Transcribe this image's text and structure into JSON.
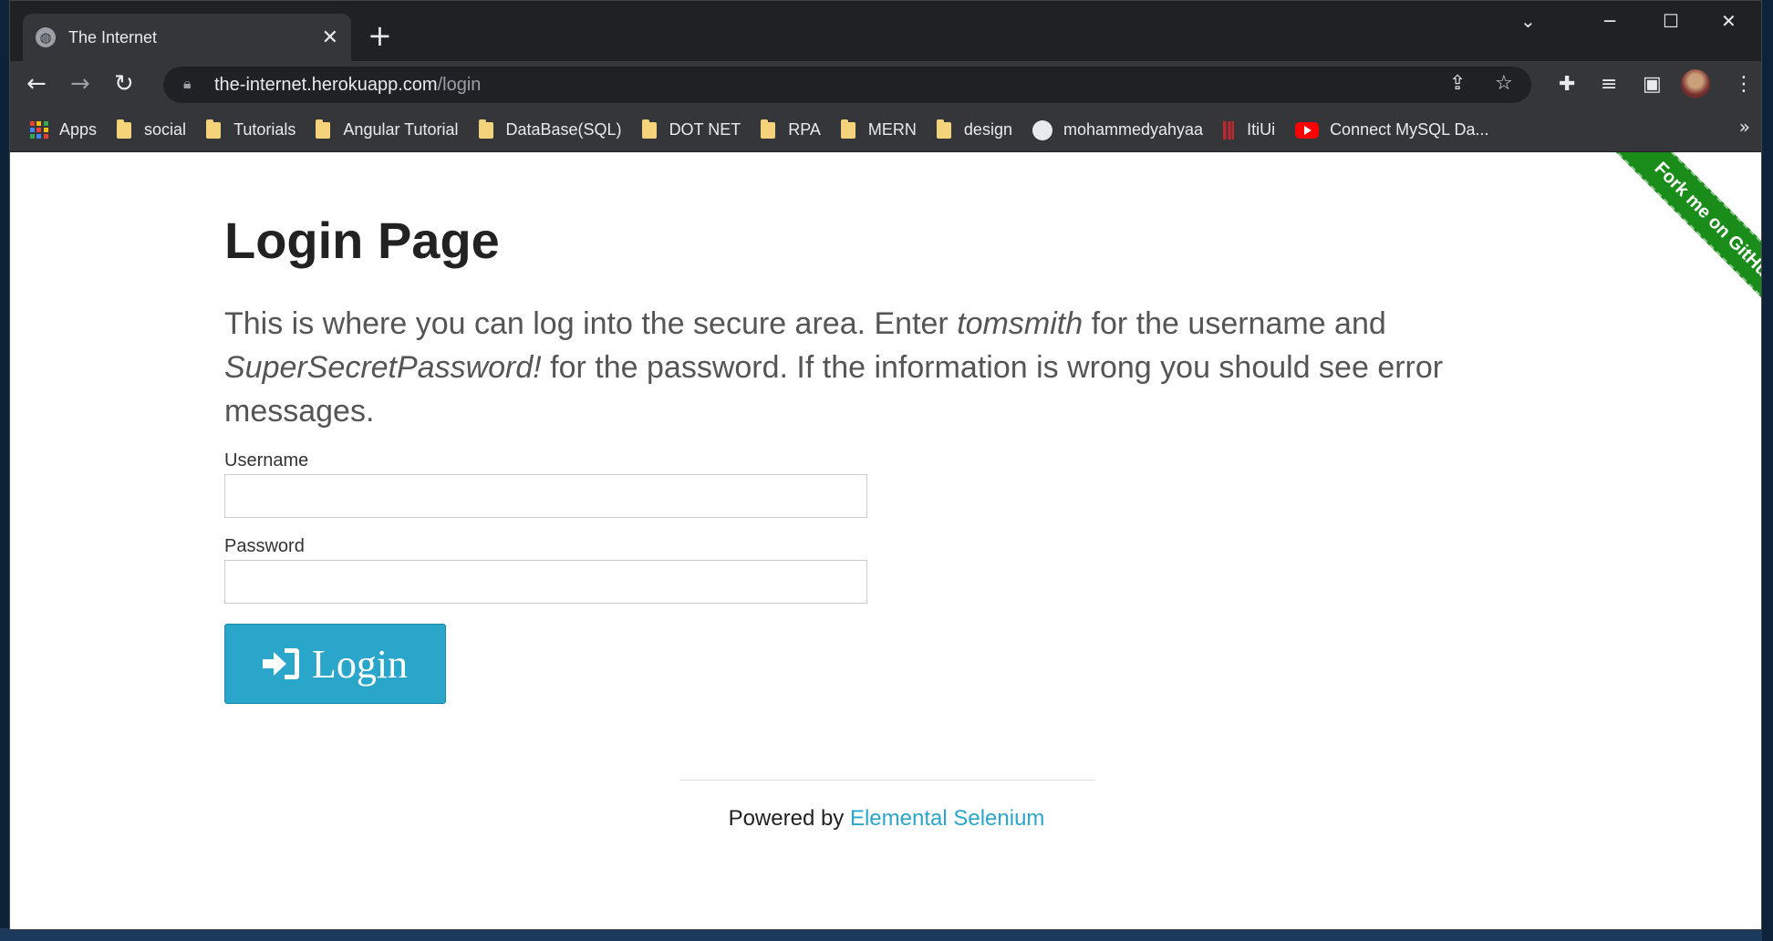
{
  "browser": {
    "tab_title": "The Internet",
    "url_host": "the-internet.herokuapp.com",
    "url_path": "/login"
  },
  "bookmarks": {
    "items": [
      {
        "label": "Apps",
        "icon": "apps-icon"
      },
      {
        "label": "social",
        "icon": "folder-icon"
      },
      {
        "label": "Tutorials",
        "icon": "folder-icon"
      },
      {
        "label": "Angular Tutorial",
        "icon": "folder-icon"
      },
      {
        "label": "DataBase(SQL)",
        "icon": "folder-icon"
      },
      {
        "label": "DOT NET",
        "icon": "folder-icon"
      },
      {
        "label": "RPA",
        "icon": "folder-icon"
      },
      {
        "label": "MERN",
        "icon": "folder-icon"
      },
      {
        "label": "design",
        "icon": "folder-icon"
      },
      {
        "label": "mohammedyahyaa",
        "icon": "github-icon"
      },
      {
        "label": "ItiUi",
        "icon": "iti-icon"
      },
      {
        "label": "Connect MySQL Da...",
        "icon": "youtube-icon"
      }
    ],
    "more": "»"
  },
  "page": {
    "title": "Login Page",
    "intro_part1": "This is where you can log into the secure area. Enter ",
    "intro_username": "tomsmith",
    "intro_part2": " for the username and ",
    "intro_password": "SuperSecretPassword!",
    "intro_part3": " for the password. If the information is wrong you should see error messages.",
    "username_label": "Username",
    "username_value": "",
    "password_label": "Password",
    "password_value": "",
    "login_label": "Login",
    "footer_prefix": "Powered by ",
    "footer_link": "Elemental Selenium",
    "ribbon_text": "Fork me on GitHub"
  },
  "colors": {
    "accent": "#2ba6cb",
    "ribbon": "#1a8c1a",
    "chrome_dark": "#202124",
    "chrome_mid": "#35363a"
  }
}
